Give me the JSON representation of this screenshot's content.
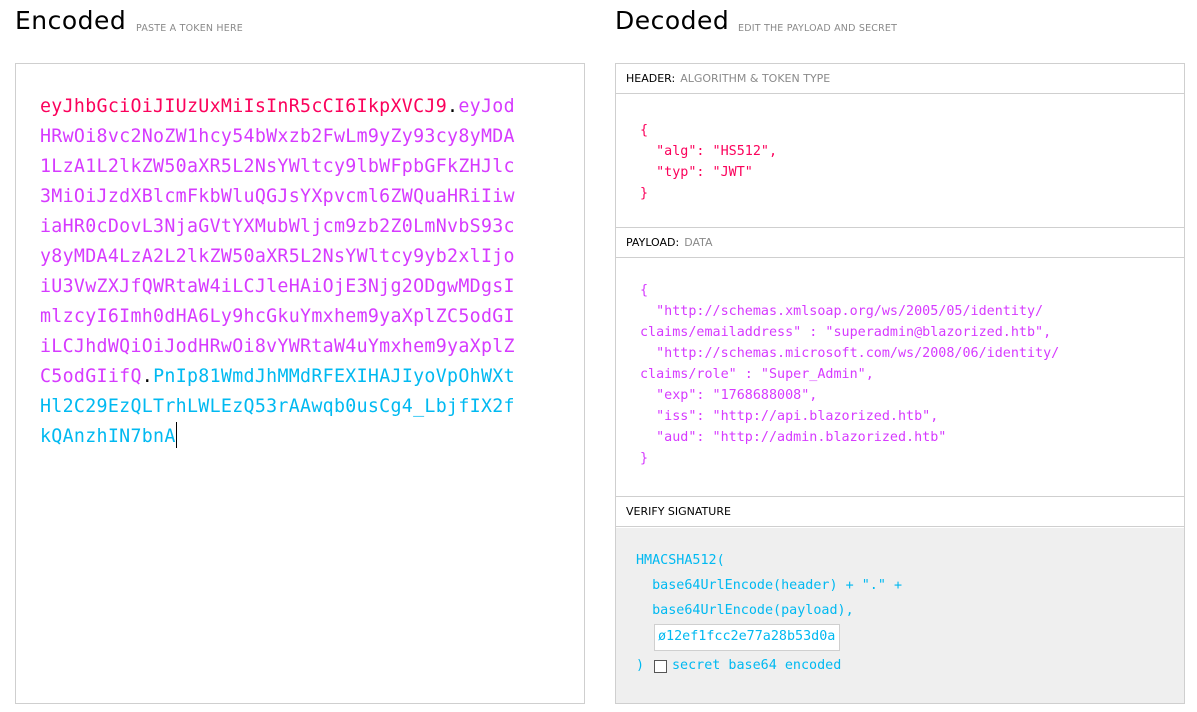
{
  "encoded": {
    "title": "Encoded",
    "subtitle": "PASTE A TOKEN HERE",
    "token_header": "eyJhbGciOiJIUzUxMiIsInR5cCI6IkpXVCJ9",
    "token_payload": "eyJodHRwOi8vc2NoZW1hcy54bWxzb2FwLm9yZy93cy8yMDA1LzA1L2lkZW50aXR5L2NsYWltcy9lbWFpbGFkZHJlc3MiOiJzdXBlcmFkbWluQGJsYXpvcml6ZWQuaHRiIiwiaHR0cDovL3NjaGVtYXMubWljcm9zb2Z0LmNvbS93cy8yMDA4LzA2L2lkZW50aXR5L2NsYWltcy9yb2xlIjoiU3VwZXJfQWRtaW4iLCJleHAiOjE3Njg2ODgwMDgsImlzcyI6Imh0dHA6Ly9hcGkuYmxhem9yaXplZC5odGIiLCJhdWQiOiJodHRwOi8vYWRtaW4uYmxhem9yaXplZC5odGIifQ",
    "token_signature": "PnIp81WmdJhMMdRFEXIHAJIyoVpOhWXtHl2C29EzQLTrhLWLEzQ53rAAwqb0usCg4_LbjfIX2fkQAnzhIN7bnA",
    "dot": "."
  },
  "decoded": {
    "title": "Decoded",
    "subtitle": "EDIT THE PAYLOAD AND SECRET",
    "header_section": {
      "label": "HEADER:",
      "sub": "ALGORITHM & TOKEN TYPE",
      "lines": [
        "{",
        "  \"alg\": \"HS512\",",
        "  \"typ\": \"JWT\"",
        "}"
      ]
    },
    "payload_section": {
      "label": "PAYLOAD:",
      "sub": "DATA",
      "lines": [
        "{",
        "  \"http://schemas.xmlsoap.org/ws/2005/05/identity/",
        "claims/emailaddress\" : \"superadmin@blazorized.htb\",",
        "  \"http://schemas.microsoft.com/ws/2008/06/identity/",
        "claims/role\" : \"Super_Admin\",",
        "  \"exp\": \"1768688008\",",
        "  \"iss\": \"http://api.blazorized.htb\",",
        "  \"aud\": \"http://admin.blazorized.htb\"",
        "}"
      ]
    },
    "verify_section": {
      "label": "VERIFY SIGNATURE",
      "line1": "HMACSHA512(",
      "line2": "  base64UrlEncode(header) + \".\" +",
      "line3": "  base64UrlEncode(payload),",
      "secret_value": "ø12ef1fcc2e77a28b53d0a",
      "close": ")",
      "checkbox_label": "secret base64 encoded"
    }
  },
  "colors": {
    "header": "#fb015b",
    "payload": "#d63aff",
    "signature": "#00b9f1"
  }
}
